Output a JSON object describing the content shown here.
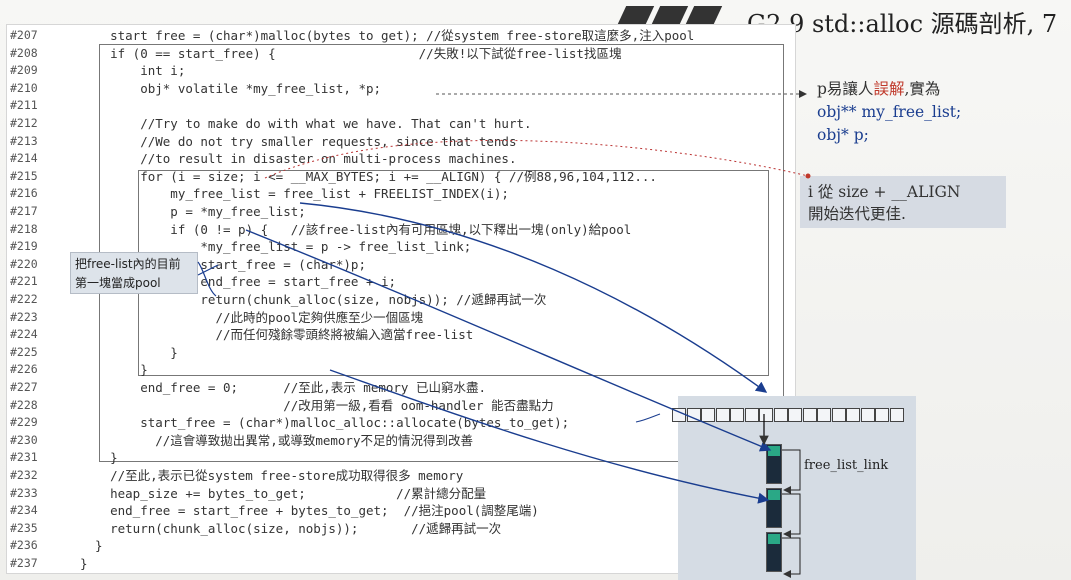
{
  "header": {
    "title": "G2.9 std::alloc 源碼剖析, 7"
  },
  "code_lines": [
    {
      "ln": "#207",
      "text": "    start free = (char*)malloc(bytes to get); //從system free-store取這麼多,注入pool"
    },
    {
      "ln": "#208",
      "text": "    if (0 == start_free) {                   //失敗!以下試從free-list找區塊"
    },
    {
      "ln": "#209",
      "text": "        int i;"
    },
    {
      "ln": "#210",
      "text": "        obj* volatile *my_free_list, *p;"
    },
    {
      "ln": "#211",
      "text": ""
    },
    {
      "ln": "#212",
      "text": "        //Try to make do with what we have. That can't hurt."
    },
    {
      "ln": "#213",
      "text": "        //We do not try smaller requests, since that tends"
    },
    {
      "ln": "#214",
      "text": "        //to result in disaster on multi-process machines."
    },
    {
      "ln": "#215",
      "text": "        for (i = size; i <= __MAX_BYTES; i += __ALIGN) { //例88,96,104,112..."
    },
    {
      "ln": "#216",
      "text": "            my_free_list = free_list + FREELIST_INDEX(i);"
    },
    {
      "ln": "#217",
      "text": "            p = *my_free_list;"
    },
    {
      "ln": "#218",
      "text": "            if (0 != p) {   //該free-list內有可用區塊,以下釋出一塊(only)給pool"
    },
    {
      "ln": "#219",
      "text": "                *my_free_list = p -> free_list_link;"
    },
    {
      "ln": "#220",
      "text": "                start_free = (char*)p;"
    },
    {
      "ln": "#221",
      "text": "                end_free = start_free + i;"
    },
    {
      "ln": "#222",
      "text": "                return(chunk_alloc(size, nobjs)); //遞歸再試一次"
    },
    {
      "ln": "#223",
      "text": "                  //此時的pool定夠供應至少一個區塊"
    },
    {
      "ln": "#224",
      "text": "                  //而任何殘餘零頭終將被編入適當free-list"
    },
    {
      "ln": "#225",
      "text": "            }"
    },
    {
      "ln": "#226",
      "text": "        }"
    },
    {
      "ln": "#227",
      "text": "        end_free = 0;      //至此,表示 memory 已山窮水盡."
    },
    {
      "ln": "#228",
      "text": "                           //改用第一級,看看 oom-handler 能否盡點力"
    },
    {
      "ln": "#229",
      "text": "        start_free = (char*)malloc_alloc::allocate(bytes_to_get);"
    },
    {
      "ln": "#230",
      "text": "          //這會導致拋出異常,或導致memory不足的情況得到改善"
    },
    {
      "ln": "#231",
      "text": "    }"
    },
    {
      "ln": "#232",
      "text": "    //至此,表示已從system free-store成功取得很多 memory"
    },
    {
      "ln": "#233",
      "text": "    heap_size += bytes_to_get;            //累計總分配量"
    },
    {
      "ln": "#234",
      "text": "    end_free = start_free + bytes_to_get;  //挹注pool(調整尾端)"
    },
    {
      "ln": "#235",
      "text": "    return(chunk_alloc(size, nobjs));       //遞歸再試一次"
    },
    {
      "ln": "#236",
      "text": "  }"
    },
    {
      "ln": "#237",
      "text": "}"
    }
  ],
  "notes": {
    "note1_line1_a": "p易讓人",
    "note1_line1_b": "誤解",
    "note1_line1_c": ",實為",
    "note1_line2": "obj** my_free_list;",
    "note1_line3": "obj* p;",
    "note2_line1": "i 從 size + __ALIGN",
    "note2_line2": "開始迭代更佳.",
    "note3_line1": "把free-list內的目前",
    "note3_line2": "第一塊當成pool"
  },
  "diagram": {
    "link_label": "free_list_link"
  },
  "colors": {
    "accent_red": "#c0392b",
    "accent_blue": "#1a3d8f",
    "node_green": "#2aa886"
  }
}
